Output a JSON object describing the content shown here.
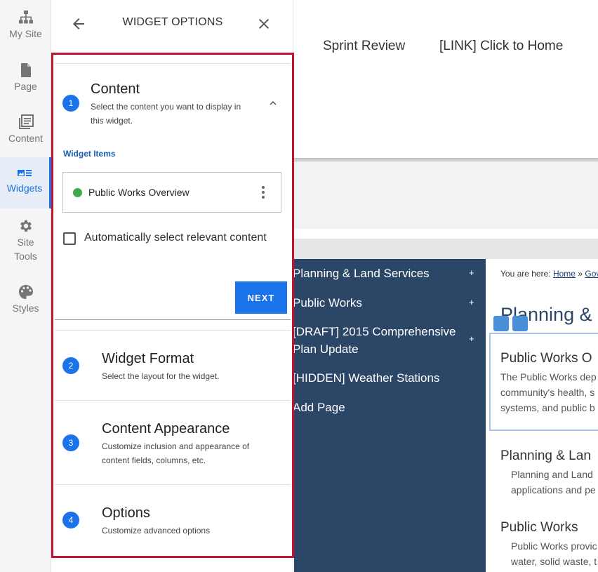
{
  "rail": {
    "items": [
      {
        "label": "My Site",
        "icon": "sitemap-icon"
      },
      {
        "label": "Page",
        "icon": "page-icon"
      },
      {
        "label": "Content",
        "icon": "content-icon"
      },
      {
        "label": "Widgets",
        "icon": "widgets-icon",
        "active": true
      },
      {
        "label": "Site Tools",
        "icon": "gear-icon"
      },
      {
        "label": "Styles",
        "icon": "palette-icon"
      }
    ]
  },
  "panel": {
    "title": "WIDGET OPTIONS",
    "steps": [
      {
        "num": "1",
        "title": "Content",
        "desc": "Select the content you want to display in this widget.",
        "expanded": true
      },
      {
        "num": "2",
        "title": "Widget Format",
        "desc": "Select the layout for the widget."
      },
      {
        "num": "3",
        "title": "Content Appearance",
        "desc": "Customize inclusion and appearance of content fields, columns, etc."
      },
      {
        "num": "4",
        "title": "Options",
        "desc": "Customize advanced options"
      }
    ],
    "content": {
      "section_label": "Widget Items",
      "item_label": "Public Works Overview",
      "item_status_color": "#3daa4d",
      "auto_select_label": "Automatically select relevant content",
      "auto_select_checked": false,
      "next_label": "NEXT"
    }
  },
  "preview": {
    "top_links": [
      "Sprint Review",
      "[LINK] Click to Home"
    ],
    "nav": [
      {
        "label": "Planning & Land Services",
        "has_children": true
      },
      {
        "label": "Public Works",
        "has_children": true
      },
      {
        "label": "[DRAFT] 2015 Comprehensive Plan Update",
        "has_children": true
      },
      {
        "label": "[HIDDEN] Weather Stations",
        "has_children": false
      },
      {
        "label": "Add Page",
        "has_children": false
      }
    ],
    "nav_plus": "+",
    "breadcrumb": {
      "prefix": "You are here:",
      "home": "Home",
      "sep": "»",
      "next": "Gov"
    },
    "heading": "Planning &",
    "cards": [
      {
        "title": "Public Works O",
        "lines": [
          "The Public Works dep",
          "community's health, s",
          "systems, and public b"
        ]
      },
      {
        "title": "Planning & Lan",
        "lines": [
          "Planning and Land",
          "applications and pe"
        ]
      },
      {
        "title": "Public Works",
        "lines": [
          "Public Works provic",
          "water, solid waste, t"
        ]
      }
    ]
  },
  "colors": {
    "accent": "#1a73e8",
    "highlight": "#c4122f",
    "nav_bg": "#2c4667"
  }
}
